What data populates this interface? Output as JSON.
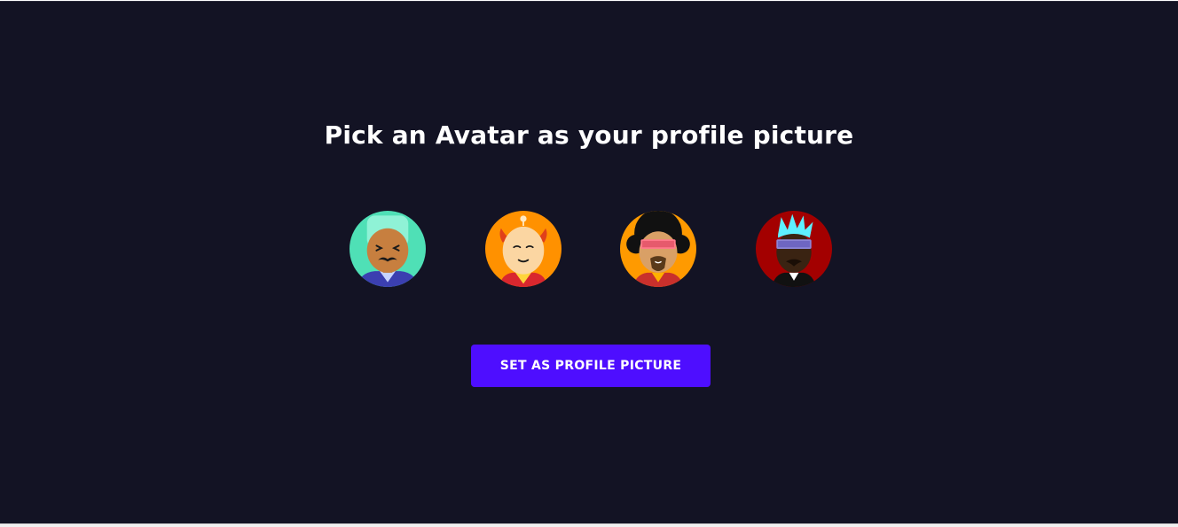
{
  "page": {
    "title": "Pick an Avatar as your profile picture",
    "submit_label": "Set as Profile Picture"
  },
  "avatars": [
    {
      "name": "avatar-teal-mustache",
      "bg": "#4fe0b6"
    },
    {
      "name": "avatar-orange-monk",
      "bg": "#ff9100"
    },
    {
      "name": "avatar-afro-sunglasses",
      "bg": "#ff9a00"
    },
    {
      "name": "avatar-red-cyan-hair",
      "bg": "#a30000"
    }
  ],
  "colors": {
    "background": "#131324",
    "accent": "#4e0eff",
    "text": "#ffffff"
  }
}
